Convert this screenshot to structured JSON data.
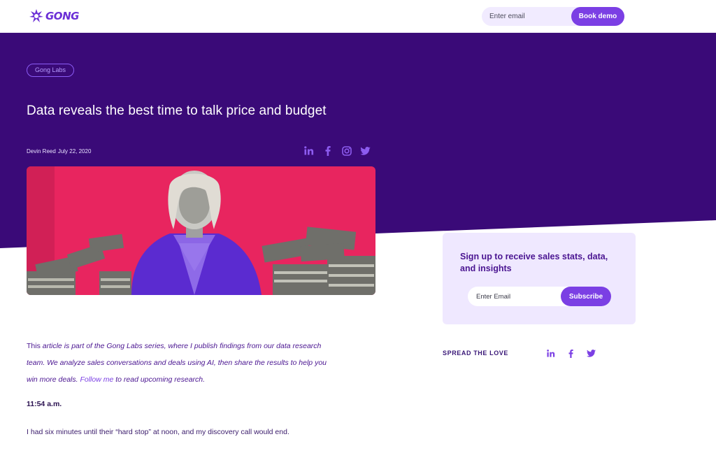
{
  "header": {
    "logo_text": "GONG",
    "email_placeholder": "Enter email",
    "book_demo_label": "Book demo"
  },
  "article": {
    "category": "Gong Labs",
    "title": "Data reveals the best time to talk price and budget",
    "author": "Devin Reed",
    "date": "July 22, 2020",
    "intro": {
      "t1": "This ",
      "t2": "article is part of the Gong Labs series, where I publish findings from our data research team. We analyze sales conversations and deals using AI, then share the results to help you win more deals. ",
      "link": "Follow me",
      "t3": " to read upcoming research."
    },
    "timestamp": "11:54 a.m.",
    "paragraph": "I had six minutes until their “hard stop” at noon, and my discovery call would end."
  },
  "share_icons_top": [
    "linkedin-icon",
    "facebook-icon",
    "instagram-icon",
    "twitter-icon"
  ],
  "sidebar": {
    "signup_title": "Sign up to receive sales stats, data, and insights",
    "email_placeholder": "Enter Email",
    "subscribe_label": "Subscribe",
    "spread_label": "SPREAD THE LOVE",
    "share_icons": [
      "linkedin-icon",
      "facebook-icon",
      "twitter-icon"
    ]
  },
  "colors": {
    "hero_purple": "#3a0a78",
    "accent": "#7b3fe4",
    "card_bg": "#efe8ff",
    "image_pink": "#e8255f"
  }
}
